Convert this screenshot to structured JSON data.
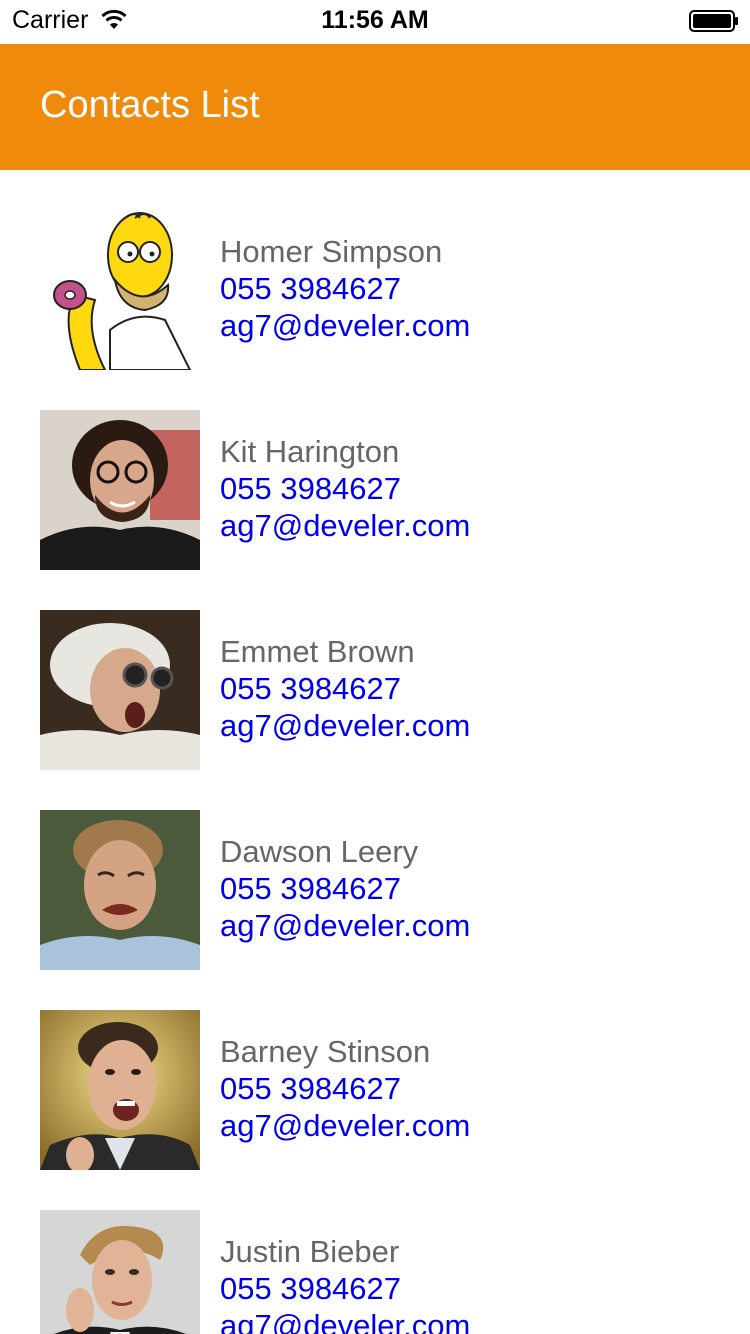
{
  "status_bar": {
    "carrier": "Carrier",
    "wifi_icon": "wifi-icon",
    "time": "11:56 AM",
    "battery_icon": "battery-full-icon"
  },
  "header": {
    "title": "Contacts List",
    "background_color": "#F08A0C"
  },
  "contacts": [
    {
      "name": "Homer Simpson",
      "phone": "055 3984627",
      "email": "ag7@develer.com",
      "avatar": "homer-simpson-avatar"
    },
    {
      "name": "Kit Harington",
      "phone": "055 3984627",
      "email": "ag7@develer.com",
      "avatar": "kit-harington-avatar"
    },
    {
      "name": "Emmet Brown",
      "phone": "055 3984627",
      "email": "ag7@develer.com",
      "avatar": "emmet-brown-avatar"
    },
    {
      "name": "Dawson Leery",
      "phone": "055 3984627",
      "email": "ag7@develer.com",
      "avatar": "dawson-leery-avatar"
    },
    {
      "name": "Barney Stinson",
      "phone": "055 3984627",
      "email": "ag7@develer.com",
      "avatar": "barney-stinson-avatar"
    },
    {
      "name": "Justin Bieber",
      "phone": "055 3984627",
      "email": "ag7@develer.com",
      "avatar": "justin-bieber-avatar"
    }
  ],
  "colors": {
    "name_text": "#666666",
    "link_text": "#0000EE"
  }
}
